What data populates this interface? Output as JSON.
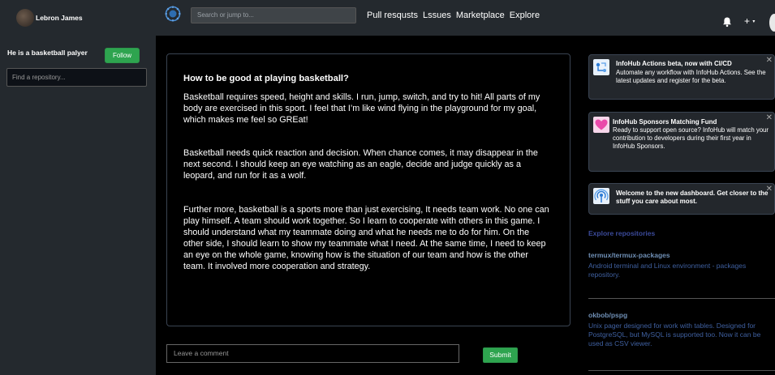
{
  "sidebar": {
    "username": "Lebron James",
    "bio": "He is a basketball palyer",
    "follow_label": "Follow",
    "repo_search_placeholder": "Find a repository..."
  },
  "topbar": {
    "search_placeholder": "Search or jump to...",
    "nav": [
      "Pull resqusts",
      "Lssues",
      "Marketplace",
      "Explore"
    ],
    "plus_label": "+",
    "dropdown_caret": "▾"
  },
  "post": {
    "title": "How to be good at playing basketball?",
    "paragraphs": [
      "Basketball requires speed, height and skills. I run, jump, switch, and try to hit! All parts of my body are exercised in this sport. I feel that I’m like wind flying in the playground for my goal, which makes me feel so GREat!",
      "Basketball needs quick reaction and decision. When chance comes, it may disappear in the next second. I should keep an eye watching as an eagle, decide and judge quickly as a leopard, and run for it as a wolf.",
      "Further more, basketball is a sports more than just exercising, It needs team work. No one can play himself. A team should work together. So I learn to cooperate with others in this game. I should understand what my teammate doing and what he needs me to do for him. On the other side, I should learn to show my teammate what I need. At the same time, I need to keep an eye on the whole game, knowing how is the situation of our team and how is the other team. It involved more cooperation and strategy."
    ]
  },
  "comment": {
    "placeholder": "Leave a comment",
    "submit_label": "Submit"
  },
  "notices": [
    {
      "icon": "actions-icon",
      "title": "InfoHub Actions beta, now with CI/CD",
      "body": "Automate any workflow with InfoHub Actions. See the latest updates and register for the beta."
    },
    {
      "icon": "heart-icon",
      "title": "InfoHub Sponsors Matching Fund",
      "body": "Ready to support open source? InfoHub will match your contribution to developers during their first year in InfoHub Sponsors."
    },
    {
      "icon": "broadcast-icon",
      "title": "Welcome to the new dashboard. Get closer to the stuff you care about most.",
      "body": ""
    }
  ],
  "explore": {
    "title": "Explore repositories",
    "repos": [
      {
        "name": "termux/termux-packages",
        "desc": "Android terminal and Linux environment - packages repository."
      },
      {
        "name": "okbob/pspg",
        "desc": "Unix pager designed for work with tables. Designed for PostgreSQL, but MySQL is supported too. Now it can be used as CSV viewer."
      }
    ]
  },
  "colors": {
    "accent_green": "#2ea44f",
    "header_bg": "#24292e",
    "link_blue": "#3f60a0"
  }
}
